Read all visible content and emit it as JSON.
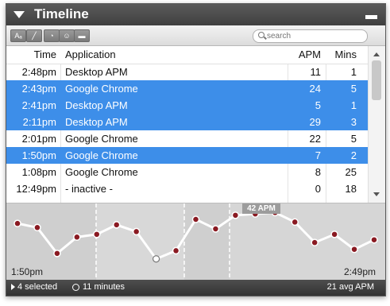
{
  "window": {
    "title": "Timeline"
  },
  "toolbar": {
    "buttons": [
      {
        "name": "text-size-button",
        "glyph": "Aₐ"
      },
      {
        "name": "chart-button",
        "glyph": "╱"
      },
      {
        "name": "pie-button",
        "glyph": "◔"
      },
      {
        "name": "users-button",
        "glyph": "☺"
      },
      {
        "name": "window-button",
        "glyph": "▬"
      }
    ],
    "search_placeholder": "search"
  },
  "table": {
    "headers": {
      "time": "Time",
      "app": "Application",
      "apm": "APM",
      "mins": "Mins"
    },
    "rows": [
      {
        "time": "2:48pm",
        "app": "Desktop APM",
        "apm": "11",
        "mins": "1",
        "selected": false
      },
      {
        "time": "2:43pm",
        "app": "Google Chrome",
        "apm": "24",
        "mins": "5",
        "selected": true
      },
      {
        "time": "2:41pm",
        "app": "Desktop APM",
        "apm": "5",
        "mins": "1",
        "selected": true
      },
      {
        "time": "2:11pm",
        "app": "Desktop APM",
        "apm": "29",
        "mins": "3",
        "selected": true
      },
      {
        "time": "2:01pm",
        "app": "Google Chrome",
        "apm": "22",
        "mins": "5",
        "selected": false
      },
      {
        "time": "1:50pm",
        "app": "Google Chrome",
        "apm": "7",
        "mins": "2",
        "selected": true
      },
      {
        "time": "1:08pm",
        "app": "Google Chrome",
        "apm": "8",
        "mins": "25",
        "selected": false
      },
      {
        "time": "12:49pm",
        "app": "- inactive -",
        "apm": "0",
        "mins": "18",
        "selected": false
      }
    ]
  },
  "graph": {
    "start_label": "1:50pm",
    "end_label": "2:49pm",
    "peak_label": "42 APM",
    "apm_values": [
      32,
      29,
      10,
      22,
      24,
      31,
      26,
      6,
      12,
      35,
      28,
      38,
      39,
      40,
      33,
      18,
      24,
      13,
      20
    ],
    "y_max": 42,
    "highlight_index": 7
  },
  "status": {
    "selected": "4 selected",
    "duration": "11 minutes",
    "avg": "21 avg APM"
  },
  "colors": {
    "selection": "#3d8ee9",
    "point": "#8a1a22"
  }
}
